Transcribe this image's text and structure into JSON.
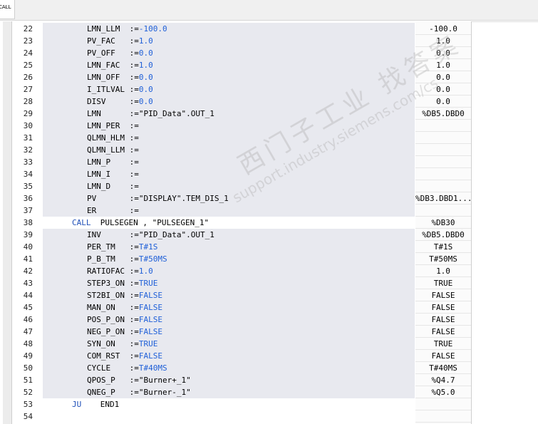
{
  "toolbar": {
    "call_button": "CALL"
  },
  "watermark": {
    "line1": "西门子工业 找答案",
    "line2": "support.industry.siemens.com/cs"
  },
  "rows": [
    {
      "num": "22",
      "name": "LMN_LLM",
      "op": ":=",
      "lit": "-100.0",
      "str": "",
      "val": "-100.0",
      "hl": true
    },
    {
      "num": "23",
      "name": "PV_FAC",
      "op": ":=",
      "lit": "1.0",
      "str": "",
      "val": "1.0",
      "hl": true
    },
    {
      "num": "24",
      "name": "PV_OFF",
      "op": ":=",
      "lit": "0.0",
      "str": "",
      "val": "0.0",
      "hl": true
    },
    {
      "num": "25",
      "name": "LMN_FAC",
      "op": ":=",
      "lit": "1.0",
      "str": "",
      "val": "1.0",
      "hl": true
    },
    {
      "num": "26",
      "name": "LMN_OFF",
      "op": ":=",
      "lit": "0.0",
      "str": "",
      "val": "0.0",
      "hl": true
    },
    {
      "num": "27",
      "name": "I_ITLVAL",
      "op": ":=",
      "lit": "0.0",
      "str": "",
      "val": "0.0",
      "hl": true
    },
    {
      "num": "28",
      "name": "DISV",
      "op": ":=",
      "lit": "0.0",
      "str": "",
      "val": "0.0",
      "hl": true
    },
    {
      "num": "29",
      "name": "LMN",
      "op": ":=",
      "lit": "",
      "str": "\"PID_Data\".OUT_1",
      "val": "%DB5.DBD0",
      "hl": true
    },
    {
      "num": "30",
      "name": "LMN_PER",
      "op": ":=",
      "lit": "",
      "str": "",
      "val": "",
      "hl": true
    },
    {
      "num": "31",
      "name": "QLMN_HLM",
      "op": ":=",
      "lit": "",
      "str": "",
      "val": "",
      "hl": true
    },
    {
      "num": "32",
      "name": "QLMN_LLM",
      "op": ":=",
      "lit": "",
      "str": "",
      "val": "",
      "hl": true
    },
    {
      "num": "33",
      "name": "LMN_P",
      "op": ":=",
      "lit": "",
      "str": "",
      "val": "",
      "hl": true
    },
    {
      "num": "34",
      "name": "LMN_I",
      "op": ":=",
      "lit": "",
      "str": "",
      "val": "",
      "hl": true
    },
    {
      "num": "35",
      "name": "LMN_D",
      "op": ":=",
      "lit": "",
      "str": "",
      "val": "",
      "hl": true
    },
    {
      "num": "36",
      "name": "PV",
      "op": ":=",
      "lit": "",
      "str": "\"DISPLAY\".TEM_DIS_1",
      "val": "%DB3.DBD1...",
      "hl": true
    },
    {
      "num": "37",
      "name": "ER",
      "op": ":=",
      "lit": "",
      "str": "",
      "val": "",
      "hl": true
    },
    {
      "num": "38",
      "kw": "CALL",
      "text": "PULSEGEN , \"PULSEGEN_1\"",
      "val": "%DB30",
      "hl": false
    },
    {
      "num": "39",
      "name": "INV",
      "op": ":=",
      "lit": "",
      "str": "\"PID_Data\".OUT_1",
      "val": "%DB5.DBD0",
      "hl": true
    },
    {
      "num": "40",
      "name": "PER_TM",
      "op": ":=",
      "lit": "T#1S",
      "str": "",
      "val": "T#1S",
      "hl": true
    },
    {
      "num": "41",
      "name": "P_B_TM",
      "op": ":=",
      "lit": "T#50MS",
      "str": "",
      "val": "T#50MS",
      "hl": true
    },
    {
      "num": "42",
      "name": "RATIOFAC",
      "op": ":=",
      "lit": "1.0",
      "str": "",
      "val": "1.0",
      "hl": true
    },
    {
      "num": "43",
      "name": "STEP3_ON",
      "op": ":=",
      "lit": "TRUE",
      "str": "",
      "val": "TRUE",
      "hl": true
    },
    {
      "num": "44",
      "name": "ST2BI_ON",
      "op": ":=",
      "lit": "FALSE",
      "str": "",
      "val": "FALSE",
      "hl": true
    },
    {
      "num": "45",
      "name": "MAN_ON",
      "op": ":=",
      "lit": "FALSE",
      "str": "",
      "val": "FALSE",
      "hl": true
    },
    {
      "num": "46",
      "name": "POS_P_ON",
      "op": ":=",
      "lit": "FALSE",
      "str": "",
      "val": "FALSE",
      "hl": true
    },
    {
      "num": "47",
      "name": "NEG_P_ON",
      "op": ":=",
      "lit": "FALSE",
      "str": "",
      "val": "FALSE",
      "hl": true
    },
    {
      "num": "48",
      "name": "SYN_ON",
      "op": ":=",
      "lit": "TRUE",
      "str": "",
      "val": "TRUE",
      "hl": true
    },
    {
      "num": "49",
      "name": "COM_RST",
      "op": ":=",
      "lit": "FALSE",
      "str": "",
      "val": "FALSE",
      "hl": true
    },
    {
      "num": "50",
      "name": "CYCLE",
      "op": ":=",
      "lit": "T#40MS",
      "str": "",
      "val": "T#40MS",
      "hl": true
    },
    {
      "num": "51",
      "name": "QPOS_P",
      "op": ":=",
      "lit": "",
      "str": "\"Burner+_1\"",
      "val": "%Q4.7",
      "hl": true
    },
    {
      "num": "52",
      "name": "QNEG_P",
      "op": ":=",
      "lit": "",
      "str": "\"Burner-_1\"",
      "val": "%Q5.0",
      "hl": true
    },
    {
      "num": "53",
      "kw": "JU",
      "text": "END1",
      "val": "",
      "hl": false
    },
    {
      "num": "54",
      "name": "",
      "op": "",
      "lit": "",
      "str": "",
      "val": "",
      "hl": false
    }
  ]
}
